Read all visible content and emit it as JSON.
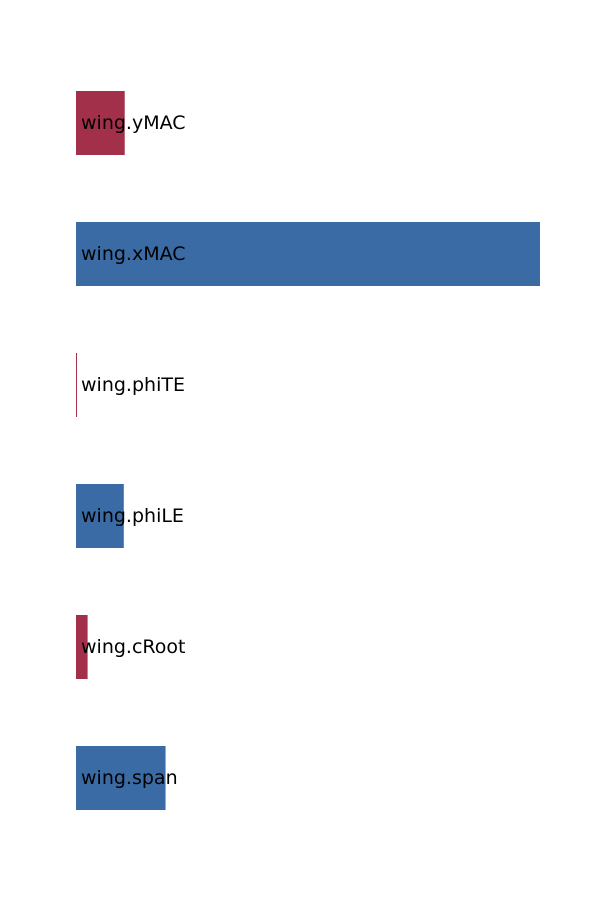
{
  "chart_data": {
    "type": "bar",
    "orientation": "horizontal",
    "categories": [
      "wing.yMAC",
      "wing.xMAC",
      "wing.phiTE",
      "wing.phiLE",
      "wing.cRoot",
      "wing.span"
    ],
    "values": [
      -0.105,
      1.0,
      -0.002,
      0.103,
      -0.025,
      0.193
    ],
    "bar_signs": [
      "negative",
      "positive",
      "negative",
      "positive",
      "negative",
      "positive"
    ],
    "title": "",
    "xlabel": "",
    "ylabel": "",
    "xlim": [
      0,
      1.0
    ],
    "grid": false,
    "legend": "none",
    "colors": {
      "positive": "#3a6ba5",
      "negative": "#a3304a"
    }
  }
}
